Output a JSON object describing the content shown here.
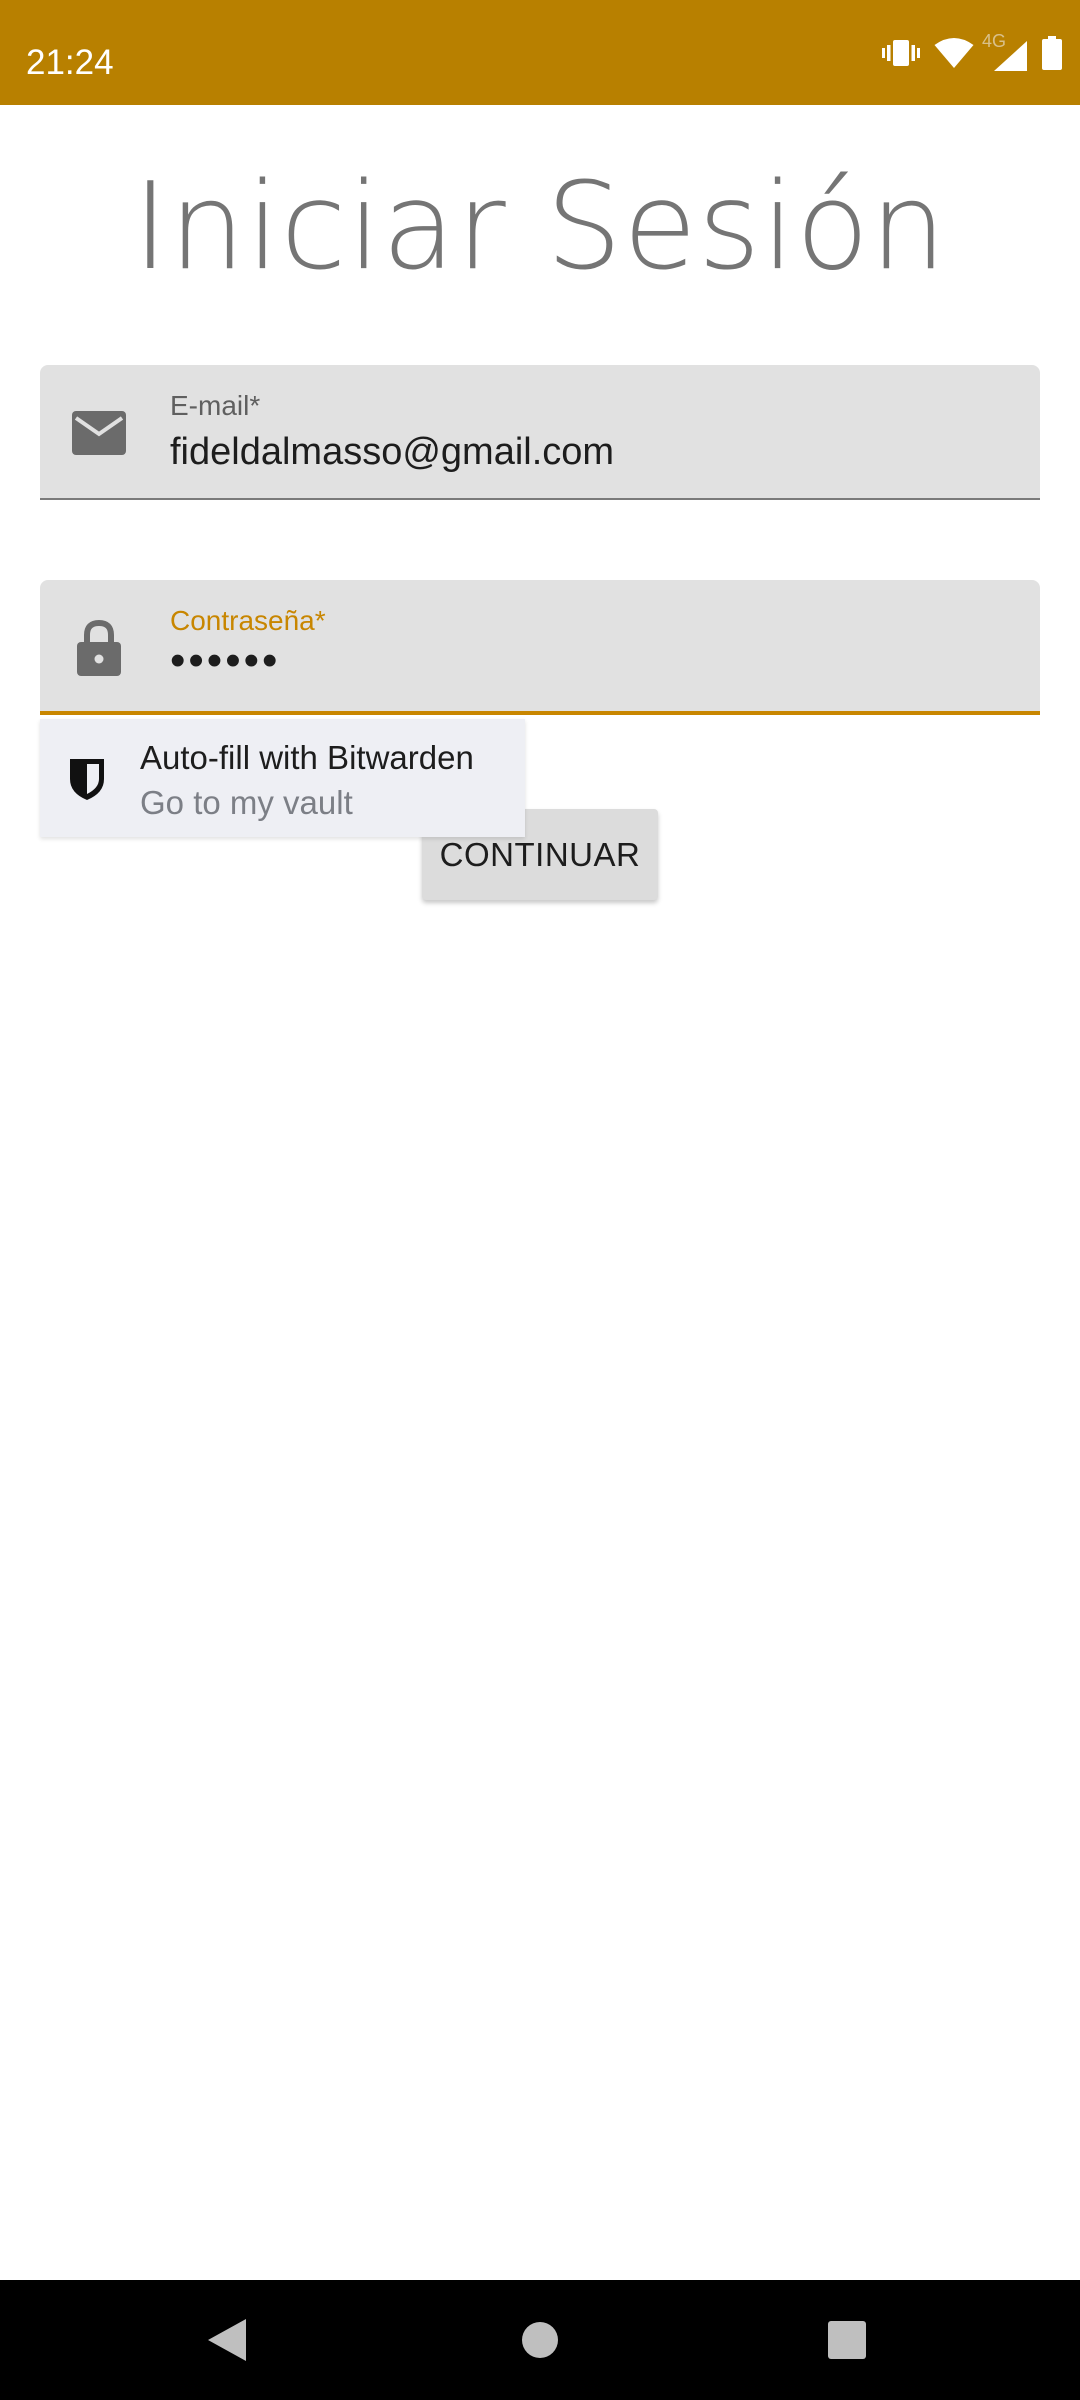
{
  "status_bar": {
    "time": "21:24",
    "network_label": "4G",
    "icons": [
      "vibrate-icon",
      "wifi-icon",
      "cellular-signal-icon",
      "battery-icon"
    ],
    "background_color": "#b88000"
  },
  "login": {
    "title": "Iniciar Sesión",
    "email_field": {
      "label": "E-mail*",
      "value": "fideldalmasso@gmail.com",
      "icon": "mail-icon"
    },
    "password_field": {
      "label": "Contraseña*",
      "value": "••••••",
      "icon": "lock-icon",
      "focused": true,
      "accent_color": "#c88600"
    },
    "continue_button": "CONTINUAR"
  },
  "autofill_popup": {
    "title": "Auto-fill with Bitwarden",
    "subtitle": "Go to my vault",
    "icon": "bitwarden-shield-icon"
  },
  "nav_bar": {
    "buttons": [
      "back-icon",
      "home-icon",
      "recents-icon"
    ]
  }
}
